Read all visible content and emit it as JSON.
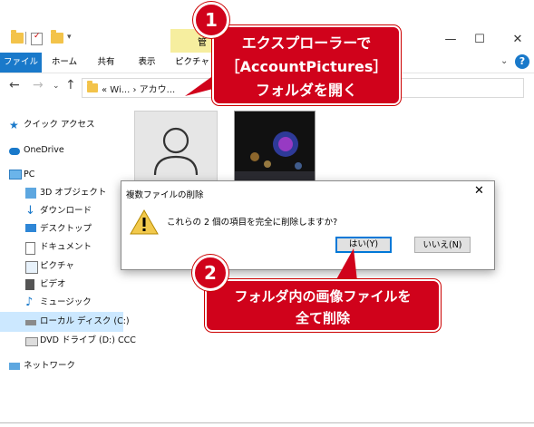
{
  "ribbon": {
    "manage_label": "管",
    "tabs": [
      "ファイル",
      "ホーム",
      "共有",
      "表示",
      "ピクチャ"
    ]
  },
  "address": {
    "crumbs": "« Wi... › アカウ..."
  },
  "sidebar": {
    "items": [
      {
        "label": "クイック アクセス",
        "icon": "star-icon"
      },
      {
        "label": "OneDrive",
        "icon": "cloud-icon"
      },
      {
        "label": "PC",
        "icon": "pc-icon"
      },
      {
        "label": "3D オブジェクト",
        "icon": "cube-icon"
      },
      {
        "label": "ダウンロード",
        "icon": "download-icon"
      },
      {
        "label": "デスクトップ",
        "icon": "desktop-icon"
      },
      {
        "label": "ドキュメント",
        "icon": "document-icon"
      },
      {
        "label": "ピクチャ",
        "icon": "picture-icon"
      },
      {
        "label": "ビデオ",
        "icon": "video-icon"
      },
      {
        "label": "ミュージック",
        "icon": "music-icon"
      },
      {
        "label": "ローカル ディスク (C:)",
        "icon": "drive-icon"
      },
      {
        "label": "DVD ドライブ (D:) CCC",
        "icon": "dvd-icon"
      },
      {
        "label": "ネットワーク",
        "icon": "network-icon"
      }
    ]
  },
  "dialog": {
    "title": "複数ファイルの削除",
    "message": "これらの 2 個の項目を完全に削除しますか?",
    "yes_label": "はい(Y)",
    "no_label": "いいえ(N)",
    "close": "✕"
  },
  "callouts": {
    "badge1": "1",
    "text1_line1": "エクスプローラーで",
    "text1_line2": "［AccountPictures］",
    "text1_line3": "フォルダを開く",
    "badge2": "2",
    "text2_line1": "フォルダ内の画像ファイルを",
    "text2_line2": "全て削除"
  },
  "colors": {
    "accent": "#1979ca",
    "callout": "#d0021b",
    "selection": "#cce8ff"
  }
}
